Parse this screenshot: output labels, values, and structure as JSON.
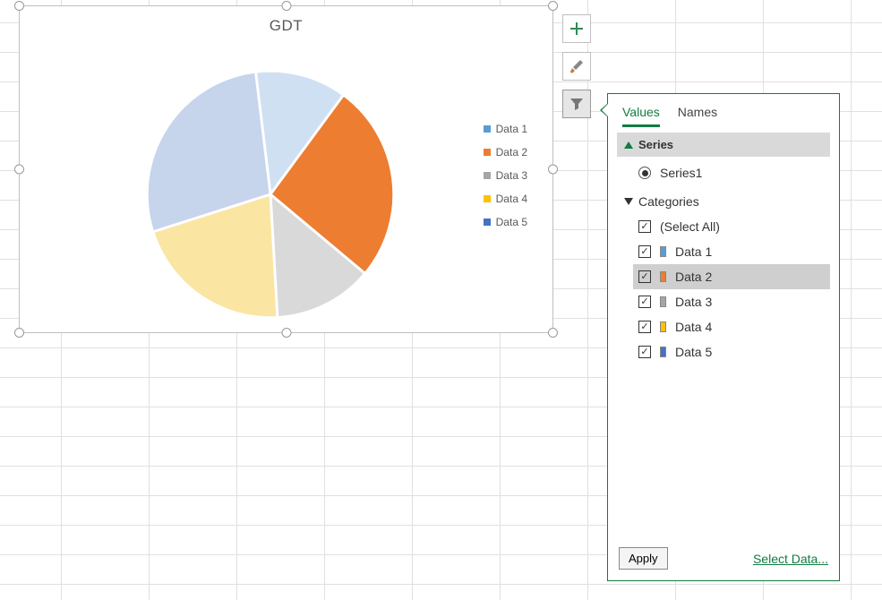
{
  "chart_data": {
    "type": "pie",
    "title": "GDT",
    "series": [
      {
        "name": "Data 1",
        "value": 12,
        "color": "#cfe0f3"
      },
      {
        "name": "Data 2",
        "value": 26,
        "color": "#ed7d31"
      },
      {
        "name": "Data 3",
        "value": 13,
        "color": "#d9d9d9"
      },
      {
        "name": "Data 4",
        "value": 21,
        "color": "#fbe5a3"
      },
      {
        "name": "Data 5",
        "value": 28,
        "color": "#c6d4ec"
      }
    ],
    "legend_colors": {
      "Data 1": "#5b9bd5",
      "Data 2": "#ed7d31",
      "Data 3": "#a5a5a5",
      "Data 4": "#ffc000",
      "Data 5": "#4472c4"
    }
  },
  "side_buttons": {
    "add": "plus-icon",
    "style": "brush-icon",
    "filter": "funnel-icon",
    "active": "filter"
  },
  "filter_panel": {
    "tabs": {
      "values": "Values",
      "names": "Names",
      "active": "values"
    },
    "series_header": "Series",
    "series_items": [
      {
        "label": "Series1",
        "selected": true
      }
    ],
    "categories_header": "Categories",
    "select_all_label": "(Select All)",
    "categories": [
      {
        "label": "Data 1",
        "checked": true,
        "color": "#5b9bd5",
        "hover": false
      },
      {
        "label": "Data 2",
        "checked": true,
        "color": "#ed7d31",
        "hover": true
      },
      {
        "label": "Data 3",
        "checked": true,
        "color": "#a5a5a5",
        "hover": false
      },
      {
        "label": "Data 4",
        "checked": true,
        "color": "#ffc000",
        "hover": false
      },
      {
        "label": "Data 5",
        "checked": true,
        "color": "#4472c4",
        "hover": false
      }
    ],
    "apply_label": "Apply",
    "select_data_label": "Select Data..."
  }
}
